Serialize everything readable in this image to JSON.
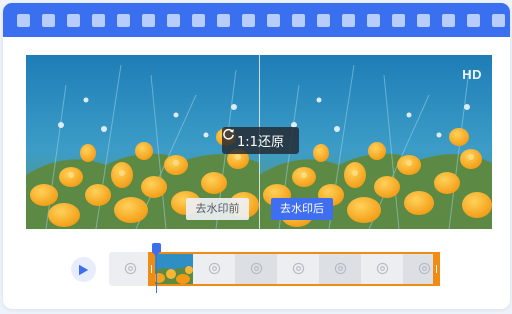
{
  "preview": {
    "hd_badge": "HD",
    "restore_label": "1:1还原",
    "before_label": "去水印前",
    "after_label": "去水印后"
  },
  "timeline": {
    "playhead_position": 0.14
  },
  "icons": {
    "play": "play-icon",
    "restore": "refresh-icon",
    "frame_placeholder": "image-placeholder-icon"
  },
  "colors": {
    "accent": "#3a6ff0",
    "selection": "#f08b14"
  }
}
